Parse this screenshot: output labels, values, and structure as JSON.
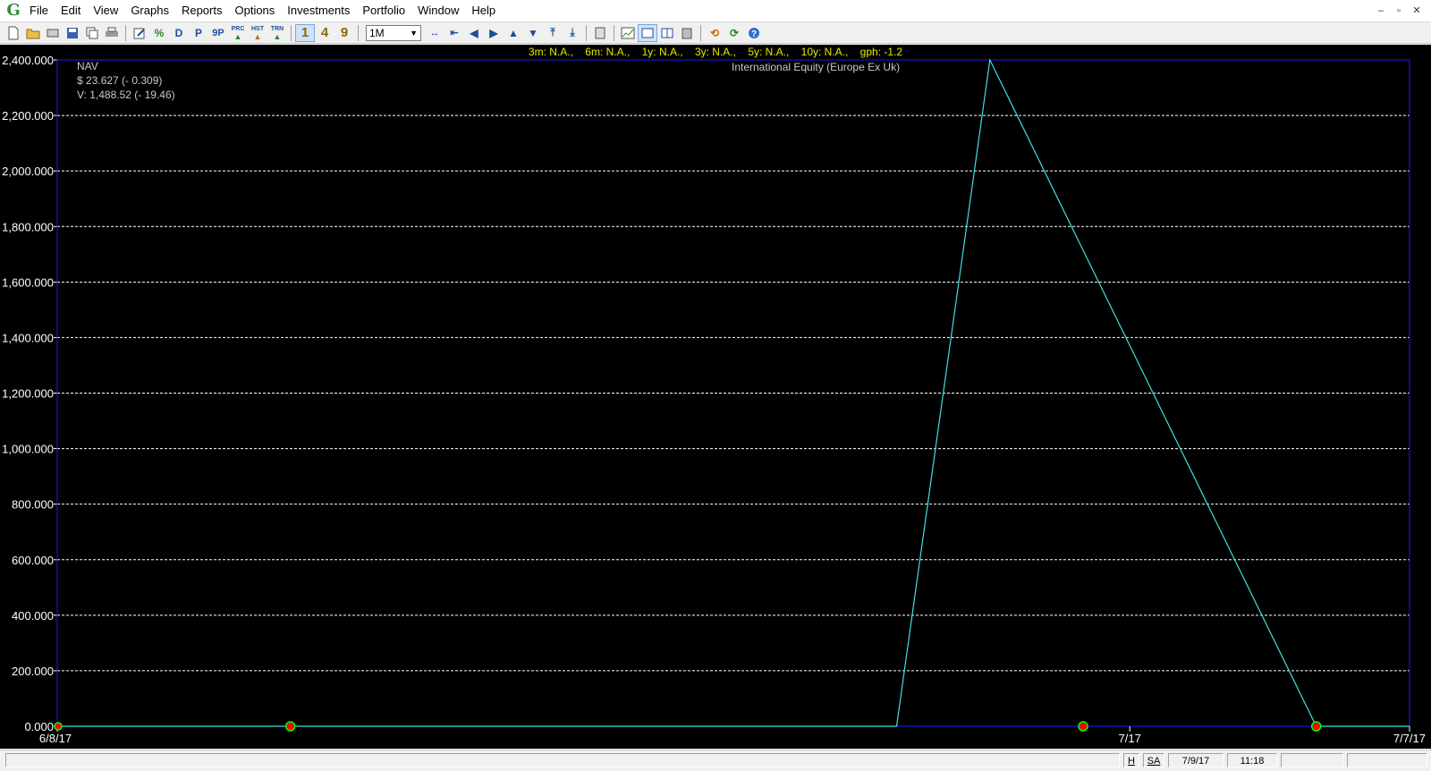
{
  "app": {
    "icon_letter": "G"
  },
  "menu": [
    "File",
    "Edit",
    "View",
    "Graphs",
    "Reports",
    "Options",
    "Investments",
    "Portfolio",
    "Window",
    "Help"
  ],
  "window_controls": [
    "–",
    "▫",
    "✕"
  ],
  "toolbar": {
    "icons": [
      "new-file-icon",
      "open-folder-icon",
      "print-preview-icon",
      "save-icon",
      "copy-icon",
      "print-icon",
      "edit-icon",
      "percent-icon"
    ],
    "d_label": "D",
    "p_label": "P",
    "nine_p_label": "9P",
    "prc_label": "PRC",
    "hst_label": "HST",
    "trn_label": "TRN",
    "num1": "1",
    "num4": "4",
    "num9": "9",
    "period": "1M"
  },
  "returns_bar": {
    "text": "3m: N.A.,    6m: N.A.,    1y: N.A.,    3y: N.A.,    5y: N.A.,    10y: N.A.,    gph: -1.2"
  },
  "legend": {
    "name": "NAV",
    "price": "$ 23.627 (- 0.309)",
    "value": "V: 1,488.52 (- 19.46)"
  },
  "subtitle": "International Equity (Europe Ex Uk)",
  "colors": {
    "line": "#40e0e0",
    "grid": "#ffffff",
    "frame": "#1a1aff",
    "marker_fill": "#ff0000",
    "marker_ring": "#00ff00",
    "tick": "#ffffff"
  },
  "chart_data": {
    "type": "line",
    "series": [
      {
        "x": [
          "2017-06-08",
          "2017-06-26",
          "2017-06-28",
          "2017-07-05",
          "2017-07-07"
        ],
        "y": [
          0,
          0,
          2400,
          0,
          0
        ]
      }
    ],
    "transactions": [
      "2017-06-13",
      "2017-06-30",
      "2017-07-05"
    ],
    "ylim": [
      0,
      2400
    ],
    "yticks": [
      0,
      200,
      400,
      600,
      800,
      1000,
      1200,
      1400,
      1600,
      1800,
      2000,
      2200,
      2400
    ],
    "ytick_labels": [
      "0.000",
      "200.000",
      "400.000",
      "600.000",
      "800.000",
      "1,000.000",
      "1,200.000",
      "1,400.000",
      "1,600.000",
      "1,800.000",
      "2,000.000",
      "2,200.000",
      "2,400.000"
    ],
    "xticks": [
      {
        "date": "2017-06-08",
        "label": "6/8/17"
      },
      {
        "date": "2017-07-01",
        "label": "7/17"
      },
      {
        "date": "2017-07-07",
        "label": "7/7/17"
      }
    ],
    "xlim": [
      "2017-06-08",
      "2017-07-07"
    ],
    "grid": true
  },
  "statusbar": {
    "h": "H",
    "sa": "SA",
    "date": "7/9/17",
    "time": "11:18"
  }
}
